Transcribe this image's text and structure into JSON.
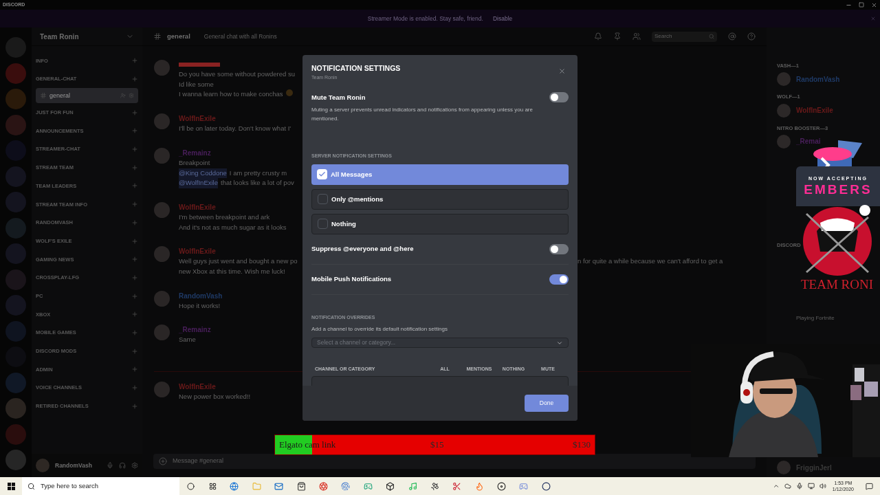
{
  "window": {
    "title": "DISCORD"
  },
  "banner": {
    "text": "Streamer Mode is enabled. Stay safe, friend.",
    "action": "Disable"
  },
  "server": {
    "name": "Team Ronin"
  },
  "sidebar": {
    "items": [
      {
        "kind": "category",
        "label": "INFO",
        "selected": false
      },
      {
        "kind": "category",
        "label": "GENERAL-CHAT",
        "selected": false
      },
      {
        "kind": "channel",
        "label": "general",
        "selected": true
      },
      {
        "kind": "category",
        "label": "JUST FOR FUN",
        "selected": false
      },
      {
        "kind": "category",
        "label": "ANNOUNCEMENTS",
        "selected": false
      },
      {
        "kind": "category",
        "label": "STREAMER-CHAT",
        "selected": false
      },
      {
        "kind": "category",
        "label": "STREAM TEAM",
        "selected": false
      },
      {
        "kind": "category",
        "label": "TEAM LEADERS",
        "selected": false
      },
      {
        "kind": "category",
        "label": "STREAM TEAM INFO",
        "selected": false
      },
      {
        "kind": "category",
        "label": "RANDOMVASH",
        "selected": false
      },
      {
        "kind": "category",
        "label": "WOLF'S EXILE",
        "selected": false
      },
      {
        "kind": "category",
        "label": "GAMING NEWS",
        "selected": false
      },
      {
        "kind": "category",
        "label": "CROSSPLAY-LFG",
        "selected": false
      },
      {
        "kind": "category",
        "label": "PC",
        "selected": false
      },
      {
        "kind": "category",
        "label": "XBOX",
        "selected": false
      },
      {
        "kind": "category",
        "label": "MOBILE GAMES",
        "selected": false
      },
      {
        "kind": "category",
        "label": "DISCORD MODS",
        "selected": false
      },
      {
        "kind": "category",
        "label": "ADMIN",
        "selected": false
      },
      {
        "kind": "category",
        "label": "VOICE CHANNELS",
        "selected": false
      },
      {
        "kind": "category",
        "label": "RETIRED CHANNELS",
        "selected": false
      }
    ],
    "user": {
      "name": "RandomVash"
    }
  },
  "channel": {
    "name": "general",
    "topic": "General chat with all Ronins",
    "search_placeholder": "Search",
    "input_placeholder": "Message #general"
  },
  "messages": [
    {
      "color": "#8a2222",
      "lines": [
        {
          "text": "Do you have some without powdered su"
        },
        {
          "text": "Id like some"
        },
        {
          "text": "I wanna learn how to make conchas"
        }
      ]
    },
    {
      "author": "WolfInExile",
      "color": "#6b1a1a",
      "lines": [
        {
          "text": "I'll be on later today. Don't know what I'"
        }
      ]
    },
    {
      "author": "_Remainz",
      "color": "#4a1f5c",
      "lines": [
        {
          "text": "Breakpoint"
        },
        {
          "mention": "@King Coddone",
          "text": "I am pretty crusty m"
        },
        {
          "mention": "@WolfInExile",
          "text": "that looks like a lot of pov"
        }
      ]
    },
    {
      "author": "WolfInExile",
      "color": "#6b1a1a",
      "lines": [
        {
          "text": "I'm between breakpoint and ark"
        },
        {
          "text": "And it's not as much sugar as it looks"
        }
      ]
    },
    {
      "author": "WolfInExile",
      "color": "#6b1a1a",
      "lines": [
        {
          "text": "Well guys just went and bought a new po",
          "after_modal": "n for quite a while because we can't afford to get a"
        },
        {
          "text": "new Xbox at this time. Wish me luck!"
        }
      ]
    },
    {
      "author": "RandomVash",
      "color": "#1f3a66",
      "lines": [
        {
          "text": "Hope it works!"
        }
      ]
    },
    {
      "author": "_Remainz",
      "color": "#4a1f5c",
      "lines": [
        {
          "text": "Same"
        }
      ]
    },
    {
      "author": "WolfInExile",
      "color": "#6b1a1a",
      "lines": [
        {
          "text": "New power box worked!!"
        }
      ]
    }
  ],
  "members": {
    "top": [
      {
        "kind": "heading",
        "text": "VASH—1"
      },
      {
        "kind": "member",
        "text": "RandomVash",
        "color": "#1f3a66"
      },
      {
        "kind": "heading",
        "text": "WOLF—1"
      },
      {
        "kind": "member",
        "text": "WolfInExile",
        "color": "#6b1a1a"
      },
      {
        "kind": "heading",
        "text": "NITRO BOOSTER—3"
      },
      {
        "kind": "member",
        "text": "_Remai",
        "color": "#4a1f5c"
      }
    ],
    "middle": [
      {
        "kind": "heading",
        "text": "DISCORD"
      },
      {
        "kind": "activity",
        "text": "Playing Fortnite"
      }
    ],
    "bottom": [
      {
        "kind": "member",
        "text": "FrigginJerl",
        "color": "#3a3a3a"
      }
    ]
  },
  "modal": {
    "title": "NOTIFICATION SETTINGS",
    "subtitle": "Team Ronin",
    "mute": {
      "label": "Mute Team Ronin",
      "on": false,
      "description": "Muting a server prevents unread indicators and notifications from appearing unless you are mentioned."
    },
    "server_settings": {
      "heading": "SERVER NOTIFICATION SETTINGS",
      "options": [
        {
          "label": "All Messages",
          "selected": true
        },
        {
          "label": "Only @mentions",
          "selected": false
        },
        {
          "label": "Nothing",
          "selected": false
        }
      ]
    },
    "toggles": [
      {
        "label": "Suppress @everyone and @here",
        "on": false
      },
      {
        "label": "Mobile Push Notifications",
        "on": true
      }
    ],
    "overrides": {
      "heading": "NOTIFICATION OVERRIDES",
      "description": "Add a channel to override its default notification settings",
      "placeholder": "Select a channel or category...",
      "columns": [
        "CHANNEL OR CATEGORY",
        "ALL",
        "MENTIONS",
        "NOTHING",
        "MUTE"
      ]
    },
    "done": "Done"
  },
  "ad": {
    "line1": "NOW ACCEPTING",
    "line2": "EMBERS"
  },
  "logo": {
    "text": "TEAM RONI"
  },
  "goal": {
    "label": "Elgato cam link",
    "current": "$15",
    "target": "$130",
    "level": 0.116
  },
  "taskbar": {
    "search_placeholder": "Type here to search",
    "time": "1:53 PM",
    "date": "1/12/2020"
  }
}
